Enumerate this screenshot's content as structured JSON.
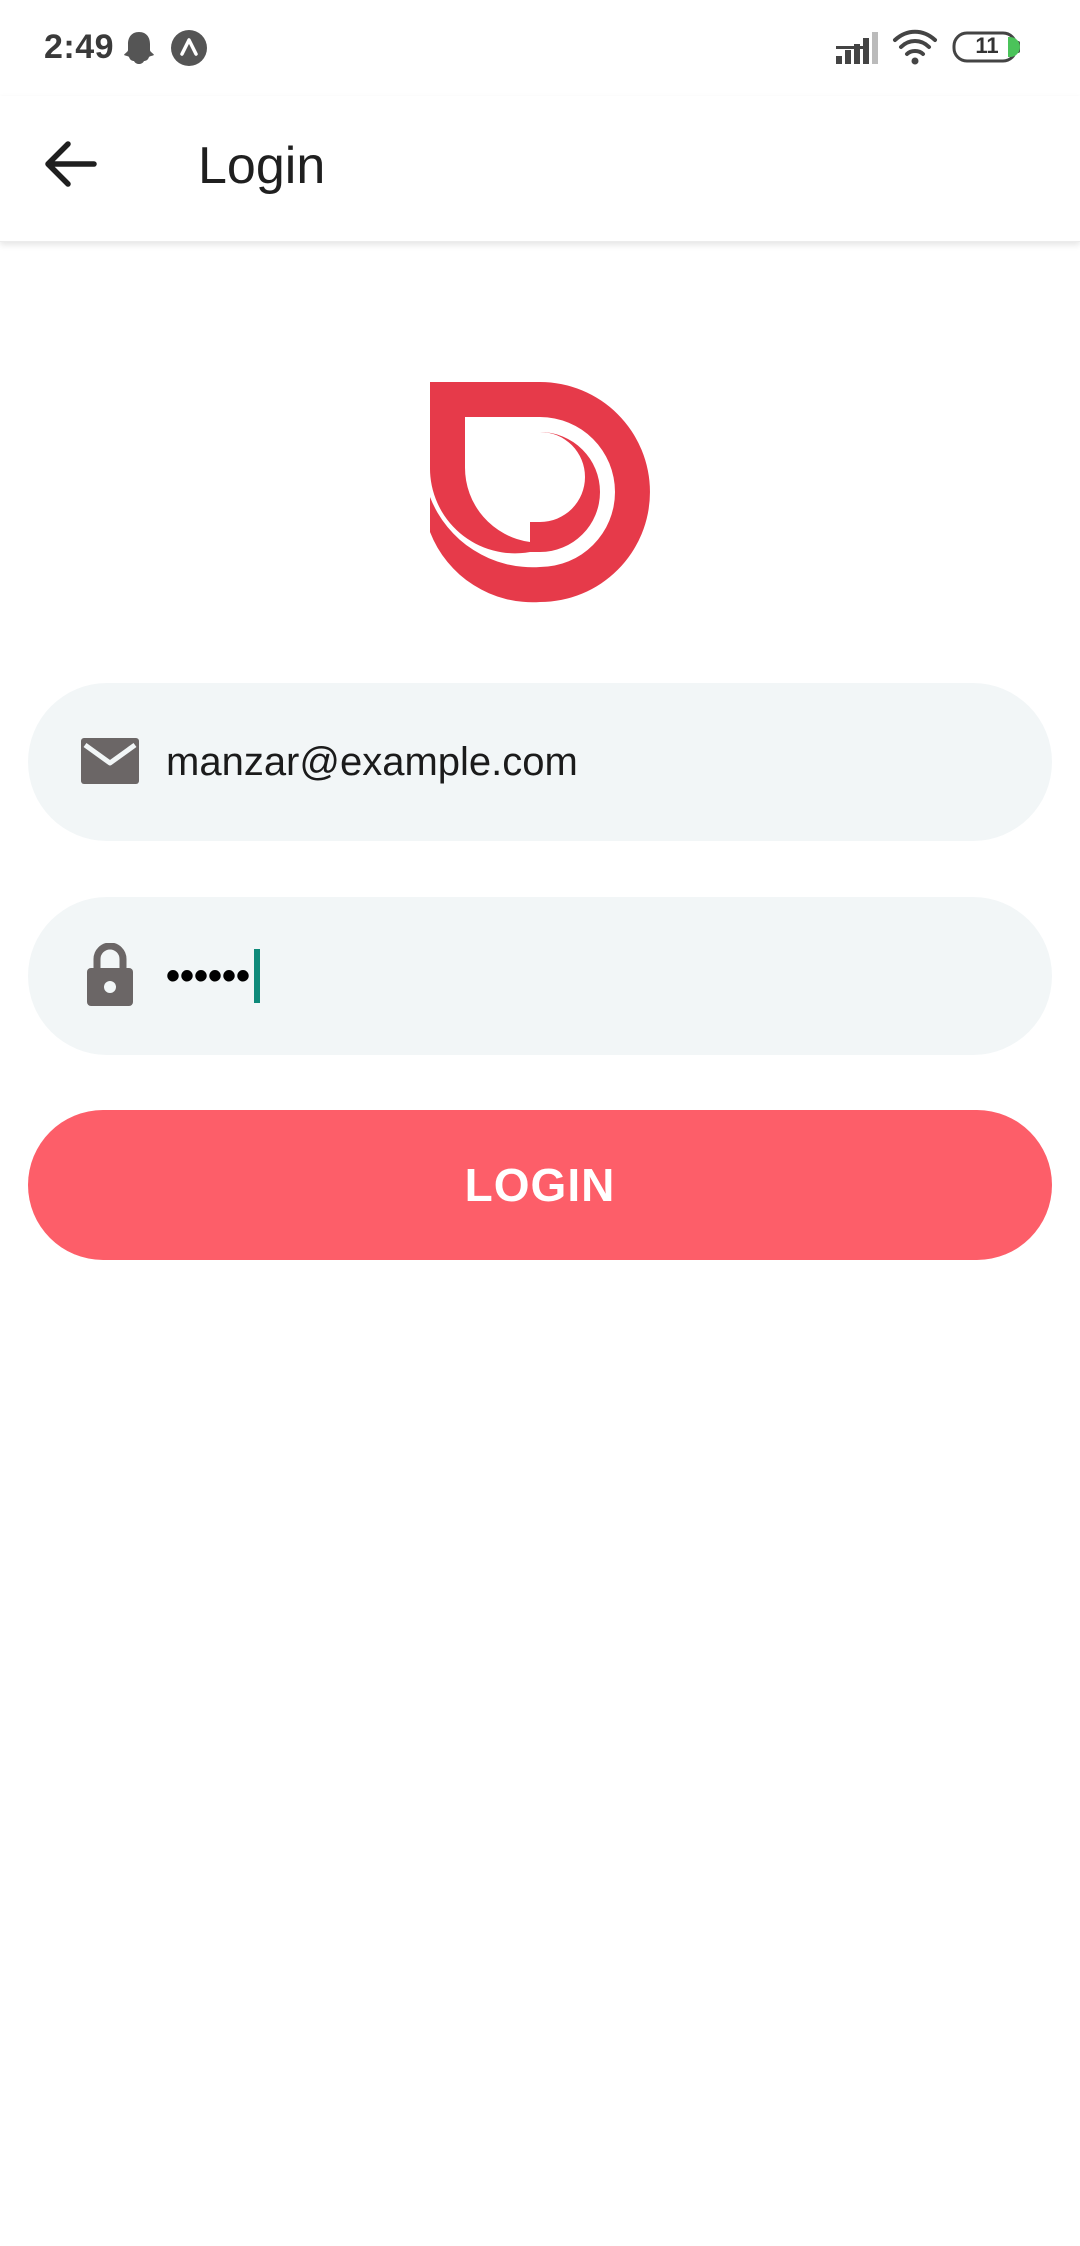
{
  "status_bar": {
    "time": "2:49",
    "battery_level": "11",
    "icons": [
      "ghost-icon",
      "nav-arrow-icon",
      "signal-icon",
      "wifi-icon",
      "battery-icon"
    ]
  },
  "app_bar": {
    "title": "Login",
    "back_icon": "arrow-left-icon"
  },
  "form": {
    "email": {
      "icon": "mail-icon",
      "value": "manzar@example.com"
    },
    "password": {
      "icon": "lock-icon",
      "masked_value": "••••••"
    },
    "login_label": "LOGIN"
  },
  "colors": {
    "brand_red": "#e63a4a",
    "button": "#fd5e69",
    "field_bg": "#f2f6f7",
    "cursor": "#0f8a7a"
  }
}
